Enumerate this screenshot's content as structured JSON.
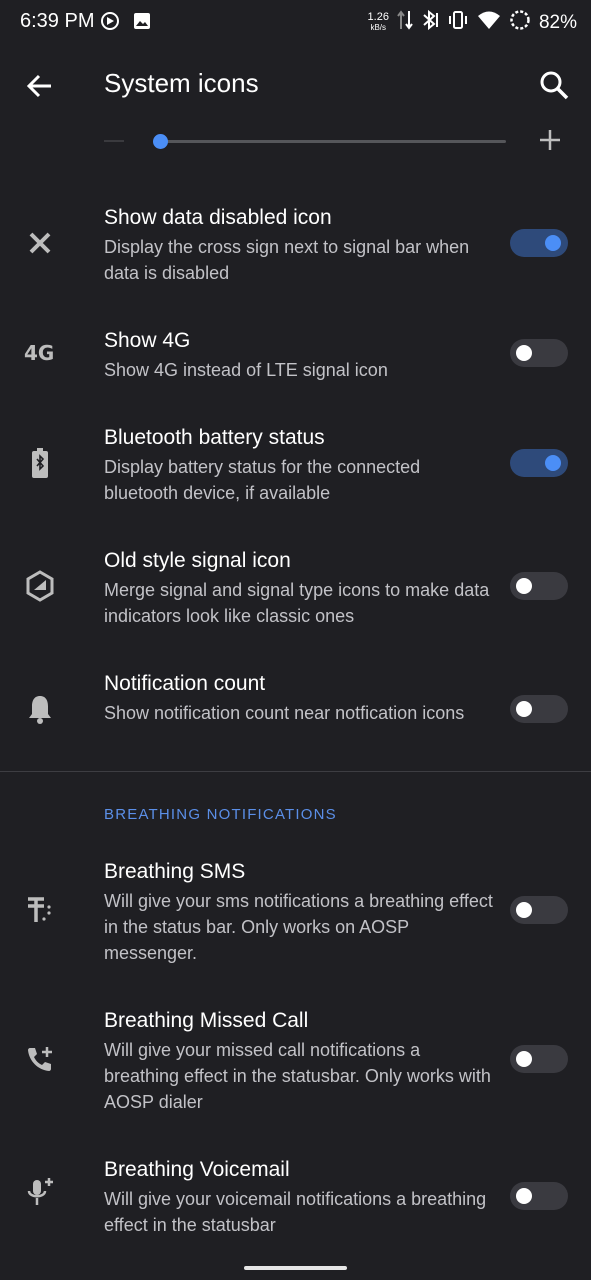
{
  "status_bar": {
    "time": "6:39 PM",
    "left_icons": [
      "media-cast-icon",
      "image-icon"
    ],
    "net_speed_value": "1.26",
    "net_speed_unit": "kB/s",
    "right_icons": [
      "data-arrows-icon",
      "bluetooth-icon",
      "vibrate-icon",
      "wifi-icon",
      "battery-saver-icon"
    ],
    "battery_percent": "82%"
  },
  "app_bar": {
    "title": "System icons",
    "back_icon": "arrow-back-icon",
    "search_icon": "search-icon"
  },
  "slider": {
    "value_fraction": 0.0
  },
  "items": [
    {
      "icon": "close-icon",
      "title": "Show data disabled icon",
      "subtitle": "Display the cross sign next to signal bar when data is disabled",
      "enabled": true
    },
    {
      "icon": "4g-icon",
      "title": "Show 4G",
      "subtitle": "Show 4G instead of LTE signal icon",
      "enabled": false
    },
    {
      "icon": "bluetooth-battery-icon",
      "title": "Bluetooth battery status",
      "subtitle": "Display battery status for the connected bluetooth device, if available",
      "enabled": true
    },
    {
      "icon": "hexagon-signal-icon",
      "title": "Old style signal icon",
      "subtitle": "Merge signal and signal type icons to make data indicators look like classic ones",
      "enabled": false
    },
    {
      "icon": "bell-icon",
      "title": "Notification count",
      "subtitle": "Show notification count near notfication icons",
      "enabled": false
    }
  ],
  "section": {
    "header": "BREATHING NOTIFICATIONS"
  },
  "breathing_items": [
    {
      "icon": "text-icon",
      "title": "Breathing SMS",
      "subtitle": "Will give your sms notifications a breathing effect in the status bar. Only works on AOSP messenger.",
      "enabled": false
    },
    {
      "icon": "phone-add-icon",
      "title": "Breathing Missed Call",
      "subtitle": "Will give your missed call notifications a breathing effect in the statusbar. Only works with AOSP dialer",
      "enabled": false
    },
    {
      "icon": "mic-add-icon",
      "title": "Breathing Voicemail",
      "subtitle": "Will give your voicemail notifications a breathing effect in the statusbar",
      "enabled": false
    }
  ],
  "colors": {
    "background": "#1f1f23",
    "accent": "#4b8ef6",
    "toggle_on_track": "#2e4a7a",
    "toggle_off_track": "#3a3a40",
    "subtitle": "#c2c2c7"
  }
}
